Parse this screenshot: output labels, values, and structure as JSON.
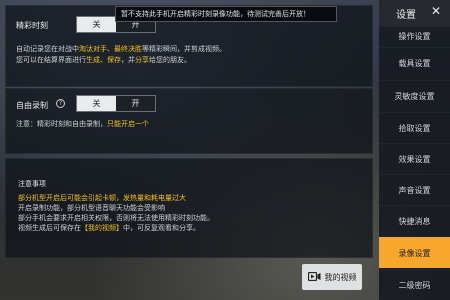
{
  "tooltip": "暂不支持此手机开启精彩时刻录像功能，待测试完善后开放！",
  "highlight": {
    "label": "精彩时刻",
    "toggle": {
      "on_label": "关",
      "off_label": "开"
    },
    "desc_line1_pre": "自动记录您在对战中",
    "desc_line1_hl": "淘汰对手、最终决胜",
    "desc_line1_post": "等精彩瞬间，并剪成视频。",
    "desc_line2_pre": "您可以在结算界面进行",
    "desc_line2_hl1": "生成、保存",
    "desc_line2_mid": "，并",
    "desc_line2_hl2": "分享",
    "desc_line2_post": "给您的朋友。"
  },
  "free_record": {
    "label": "自由录制",
    "help_icon": "?",
    "toggle": {
      "on_label": "关",
      "off_label": "开"
    },
    "note_pre": "注意：精彩时刻和自由录制，",
    "note_hl": "只能开启一个"
  },
  "notes": {
    "title": "注意事项",
    "line1": "部分机型开启后可能会引起卡顿，发热量和耗电量过大",
    "line2": "开启录制功能，部分机型语音聊天功能会受影响",
    "line3": "部分手机会要求开启相关权限，否则将无法使用精彩时刻功能。",
    "line4_pre": "视频生成后可保存在",
    "line4_hl": "【我的视频】",
    "line4_post": "中，可反复观看和分享。"
  },
  "my_video_button": {
    "icon": "video-camera-icon",
    "label": "我的视频"
  },
  "sidebar": {
    "title": "设置",
    "close_icon": "✕",
    "items": [
      {
        "label": "操作设置"
      },
      {
        "label": "载具设置"
      },
      {
        "label": "灵敏度设置"
      },
      {
        "label": "拾取设置"
      },
      {
        "label": "效果设置"
      },
      {
        "label": "声音设置"
      },
      {
        "label": "快捷消息"
      },
      {
        "label": "录像设置",
        "active": true
      },
      {
        "label": "二级密码"
      }
    ]
  },
  "colors": {
    "accent": "#f7a72b",
    "highlight_text": "#f3c318"
  }
}
